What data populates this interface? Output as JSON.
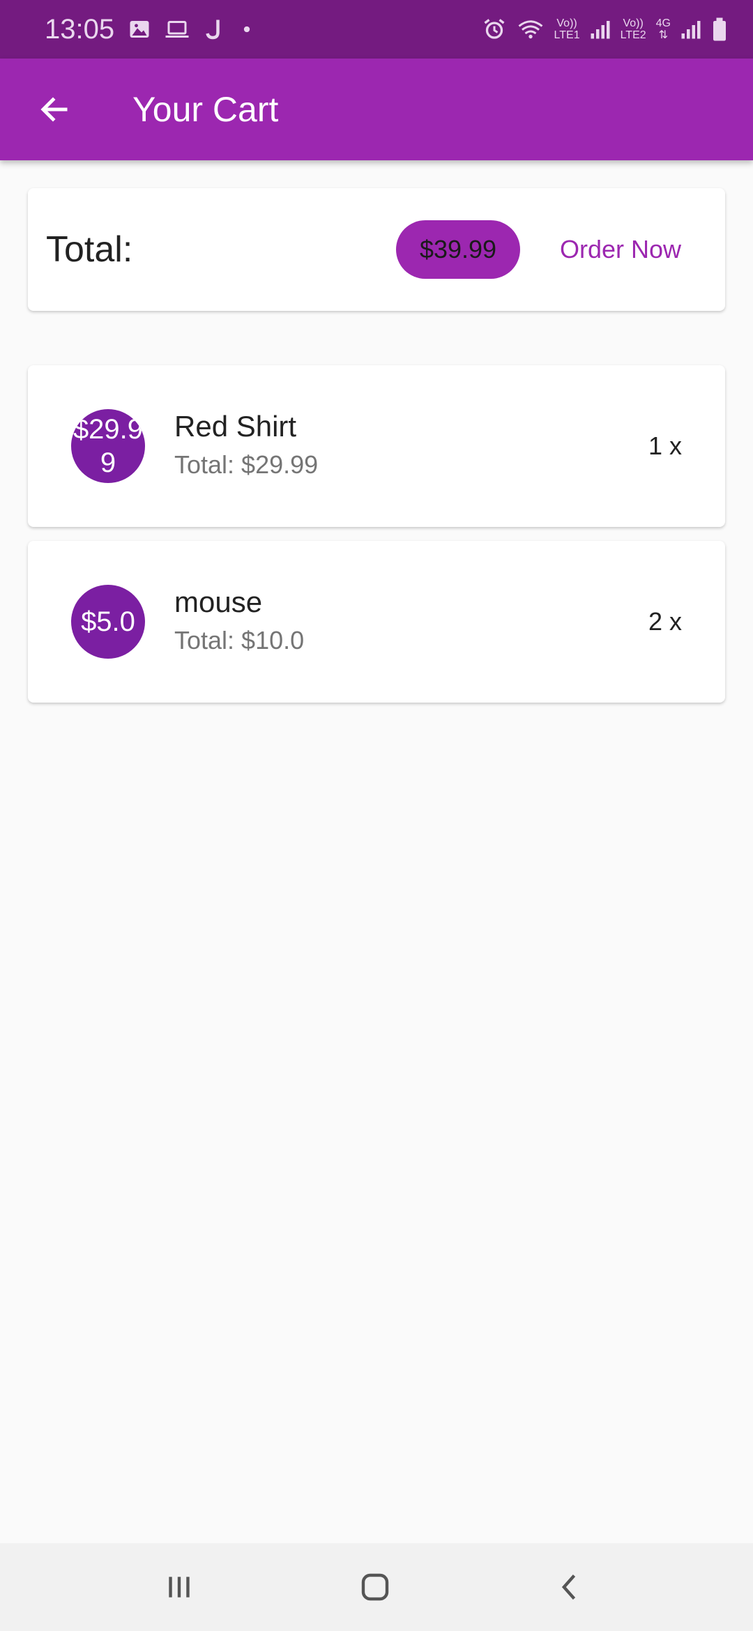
{
  "status_bar": {
    "time": "13:05",
    "sim1_top": "Vo))",
    "sim1_bottom": "LTE1",
    "sim2_top": "Vo))",
    "sim2_bottom": "LTE2",
    "network": "4G"
  },
  "app_bar": {
    "title": "Your Cart"
  },
  "summary": {
    "total_label": "Total:",
    "total_amount": "$39.99",
    "order_button_label": "Order Now"
  },
  "items": [
    {
      "price": "$29.99",
      "name": "Red Shirt",
      "total": "Total: $29.99",
      "quantity": "1 x"
    },
    {
      "price": "$5.0",
      "name": "mouse",
      "total": "Total: $10.0",
      "quantity": "2 x"
    }
  ],
  "colors": {
    "primary": "#9c27b0",
    "primary_dark": "#741b80",
    "avatar": "#7b1fa2"
  }
}
